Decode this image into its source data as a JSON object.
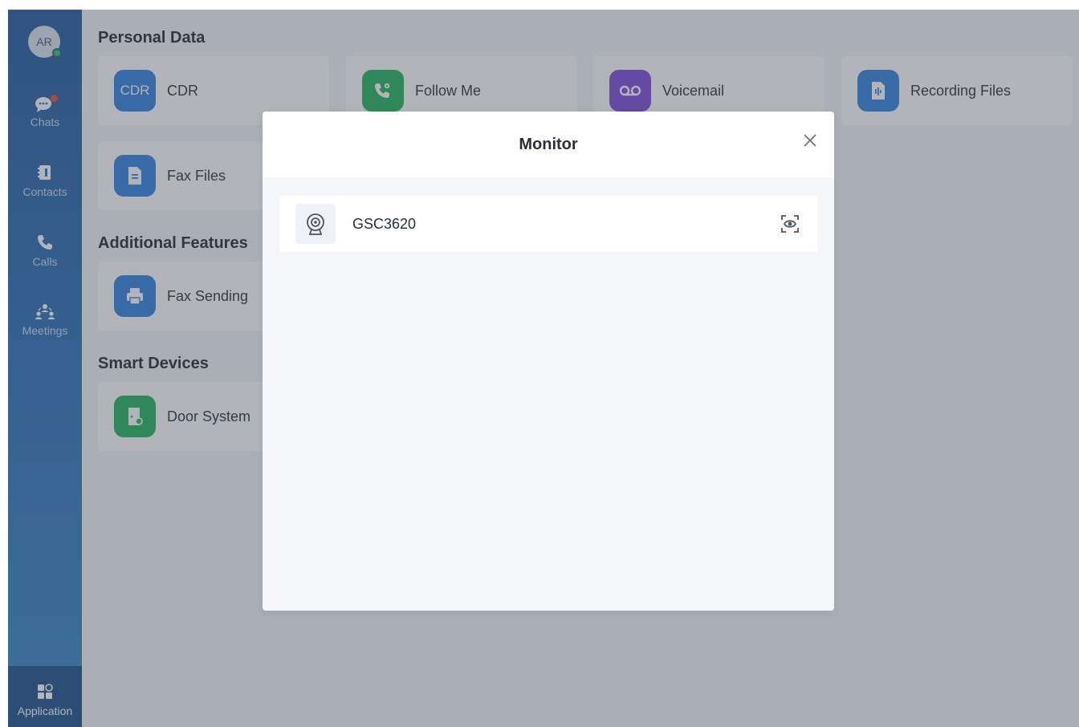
{
  "user": {
    "avatar_initials": "AR",
    "status": "online"
  },
  "sidebar": {
    "items": [
      {
        "label": "Chats",
        "icon": "chat-bubble-icon",
        "has_badge": true
      },
      {
        "label": "Contacts",
        "icon": "contacts-book-icon"
      },
      {
        "label": "Calls",
        "icon": "phone-icon"
      },
      {
        "label": "Meetings",
        "icon": "meeting-people-icon"
      }
    ],
    "bottom": {
      "label": "Application",
      "icon": "apps-grid-icon",
      "active": true
    }
  },
  "sections": {
    "personal_data": {
      "title": "Personal Data",
      "cards": [
        {
          "label": "CDR",
          "tile_text": "CDR",
          "color": "#2f7ee0"
        },
        {
          "label": "Follow Me",
          "icon": "phone-gear-icon",
          "color": "#1fb15a"
        },
        {
          "label": "Voicemail",
          "icon": "voicemail-icon",
          "color": "#7a47d6"
        },
        {
          "label": "Recording Files",
          "icon": "audio-file-icon",
          "color": "#2f7ee0"
        },
        {
          "label": "Fax Files",
          "icon": "document-icon",
          "color": "#2f7ee0"
        }
      ]
    },
    "additional_features": {
      "title": "Additional Features",
      "cards": [
        {
          "label": "Fax Sending",
          "icon": "printer-icon",
          "color": "#2f7ee0"
        }
      ]
    },
    "smart_devices": {
      "title": "Smart Devices",
      "cards": [
        {
          "label": "Door System",
          "icon": "door-icon",
          "color": "#1fb15a"
        }
      ]
    }
  },
  "modal": {
    "title": "Monitor",
    "devices": [
      {
        "name": "GSC3620",
        "icon": "camera-icon",
        "action_icon": "monitor-eye-icon"
      }
    ]
  },
  "colors": {
    "sidebar_top": "#23589c",
    "sidebar_bottom": "#3a87c9",
    "overlay": "rgba(70,78,90,0.42)",
    "presence": "#2bbf62",
    "badge": "#f0453a"
  }
}
